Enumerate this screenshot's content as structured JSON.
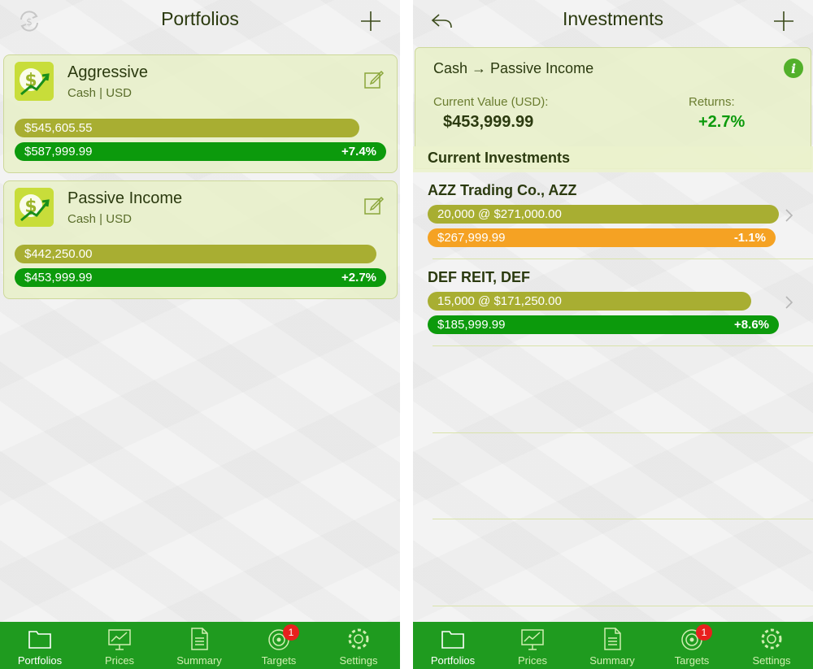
{
  "portfolios_screen": {
    "title": "Portfolios",
    "cards": [
      {
        "name": "Aggressive",
        "subtitle": "Cash | USD",
        "cost_bar": "$545,605.55",
        "value_bar": "$587,999.99",
        "returns": "+7.4%"
      },
      {
        "name": "Passive Income",
        "subtitle": "Cash | USD",
        "cost_bar": "$442,250.00",
        "value_bar": "$453,999.99",
        "returns": "+2.7%"
      }
    ]
  },
  "investments_screen": {
    "title": "Investments",
    "path": "Cash → Passive Income",
    "current_value_label": "Current Value (USD):",
    "current_value": "$453,999.99",
    "returns_label": "Returns:",
    "returns": "+2.7%",
    "section_title": "Current Investments",
    "items": [
      {
        "name": "AZZ Trading Co., AZZ",
        "cost_bar": "20,000 @ $271,000.00",
        "value_bar": "$267,999.99",
        "returns": "-1.1%"
      },
      {
        "name": "DEF REIT, DEF",
        "cost_bar": "15,000 @ $171,250.00",
        "value_bar": "$185,999.99",
        "returns": "+8.6%"
      }
    ]
  },
  "tabbar": {
    "portfolios": "Portfolios",
    "prices": "Prices",
    "summary": "Summary",
    "targets": "Targets",
    "targets_badge": "1",
    "settings": "Settings"
  },
  "colors": {
    "tab_green": "#1f9b1f",
    "bar_olive": "#a8ae32",
    "bar_green": "#0c9a0c",
    "bar_orange": "#f5a223",
    "badge_red": "#e8201e"
  }
}
